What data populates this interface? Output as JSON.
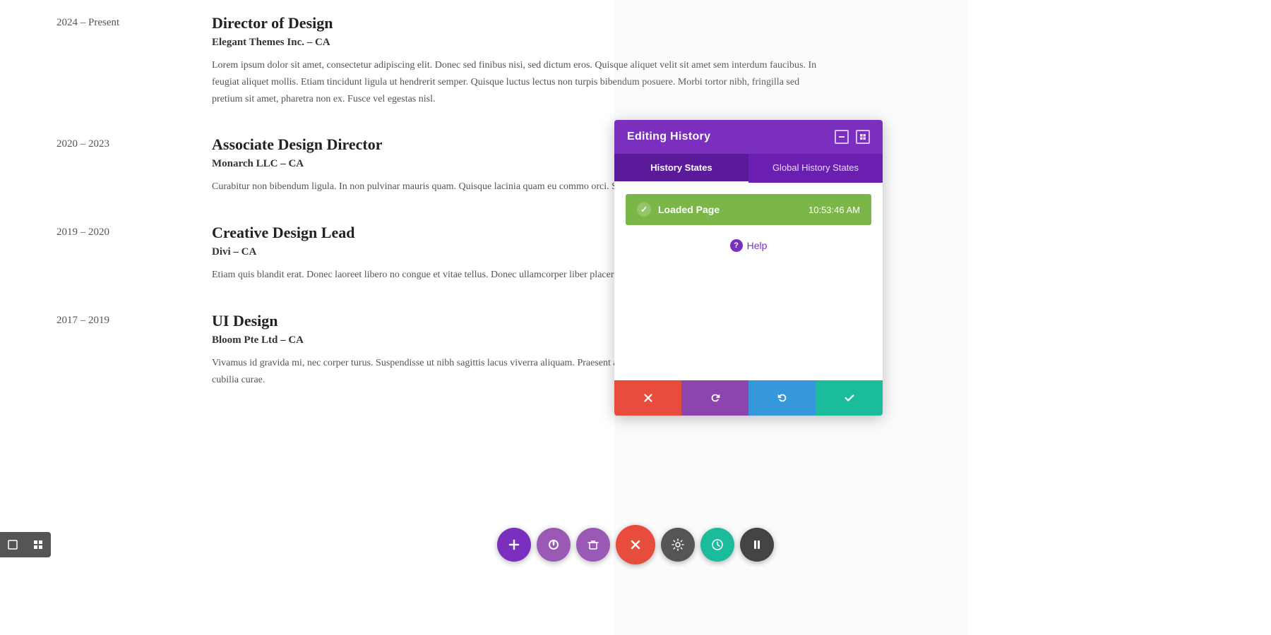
{
  "timeline": {
    "entries": [
      {
        "years": "2024 – Present",
        "title": "Director of Design",
        "company": "Elegant Themes Inc. – CA",
        "description": "Lorem ipsum dolor sit amet, consectetur adipiscing elit. Donec sed finibus nisi, sed dictum eros. Quisque aliquet velit sit amet sem interdum faucibus. In feugiat aliquet mollis. Etiam tincidunt ligula ut hendrerit semper. Quisque luctus lectus non turpis bibendum posuere. Morbi tortor nibh, fringilla sed pretium sit amet, pharetra non ex. Fusce vel egestas nisl."
      },
      {
        "years": "2020 – 2023",
        "title": "Associate Design Director",
        "company": "Monarch LLC – CA",
        "description": "Curabitur non bibendum ligula. In non pulvinar mauris quam. Quisque lacinia quam eu commo orci. Sed vitae nulla et justo pellentesque congu... a elit. Fusce ut , ultricies eget"
      },
      {
        "years": "2019 – 2020",
        "title": "Creative Design Lead",
        "company": "Divi – CA",
        "description": "Etiam quis blandit erat. Donec laoreet libero no congue et vitae tellus. Donec ullamcorper liber placerat eget, sollicitudin a sapien. Cras ut auct felis pellentesque fringilla nec"
      },
      {
        "years": "2017 – 2019",
        "title": "UI Design",
        "company": "Bloom Pte Ltd – CA",
        "description": "Vivamus id gravida mi, nec corper turus. Suspendisse ut nibh sagittis lacus viverra aliquam. Praesent ac lobortis faucibus orci luctus et ultrices posuere cubilia curae."
      }
    ]
  },
  "editing_history_panel": {
    "title": "Editing History",
    "minimize_icon": "minimize",
    "grid_icon": "grid",
    "tabs": [
      {
        "label": "History States",
        "active": true
      },
      {
        "label": "Global History States",
        "active": false
      }
    ],
    "history_item": {
      "label": "Loaded Page",
      "time": "10:53:46 AM",
      "icon": "check"
    },
    "help_label": "Help",
    "actions": [
      {
        "id": "cancel",
        "color": "red",
        "icon": "×"
      },
      {
        "id": "undo",
        "color": "purple",
        "icon": "undo"
      },
      {
        "id": "redo",
        "color": "blue",
        "icon": "redo"
      },
      {
        "id": "save",
        "color": "green",
        "icon": "check"
      }
    ]
  },
  "floating_toolbar": {
    "buttons": [
      {
        "id": "add",
        "icon": "+",
        "color": "purple-dark"
      },
      {
        "id": "power",
        "icon": "power",
        "color": "purple-mid"
      },
      {
        "id": "trash",
        "icon": "trash",
        "color": "purple-mid"
      },
      {
        "id": "close",
        "icon": "×",
        "color": "close-red"
      },
      {
        "id": "settings",
        "icon": "gear",
        "color": "gray-dark"
      },
      {
        "id": "history",
        "icon": "history",
        "color": "teal"
      },
      {
        "id": "pause",
        "icon": "pause",
        "color": "dark"
      }
    ]
  },
  "left_panel": {
    "buttons": [
      {
        "id": "left-square",
        "icon": "square"
      },
      {
        "id": "left-grid",
        "icon": "grid"
      }
    ]
  }
}
